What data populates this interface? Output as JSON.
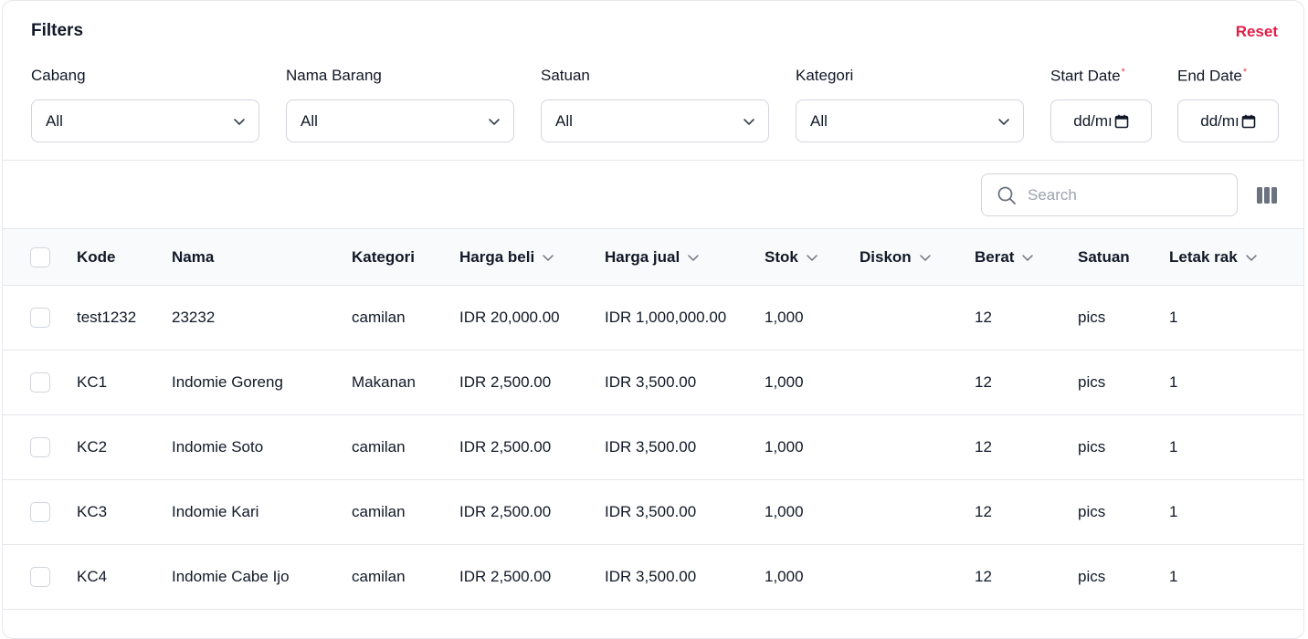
{
  "filters": {
    "title": "Filters",
    "reset_label": "Reset",
    "cabang": {
      "label": "Cabang",
      "value": "All"
    },
    "nama_barang": {
      "label": "Nama Barang",
      "value": "All"
    },
    "satuan": {
      "label": "Satuan",
      "value": "All"
    },
    "kategori": {
      "label": "Kategori",
      "value": "All"
    },
    "start_date": {
      "label": "Start Date",
      "required_mark": "*",
      "value": "dd/mı"
    },
    "end_date": {
      "label": "End Date",
      "required_mark": "*",
      "value": "dd/mı"
    }
  },
  "toolbar": {
    "search_placeholder": "Search",
    "icons": [
      "search-icon",
      "columns-icon"
    ]
  },
  "table": {
    "headers": {
      "kode": "Kode",
      "nama": "Nama",
      "kategori": "Kategori",
      "harga_beli": "Harga beli",
      "harga_jual": "Harga jual",
      "stok": "Stok",
      "diskon": "Diskon",
      "berat": "Berat",
      "satuan": "Satuan",
      "letak_rak": "Letak rak"
    },
    "rows": [
      {
        "kode": "test1232",
        "nama": "23232",
        "kategori": "camilan",
        "harga_beli": "IDR 20,000.00",
        "harga_jual": "IDR 1,000,000.00",
        "stok": "1,000",
        "diskon": "",
        "berat": "12",
        "satuan": "pics",
        "letak_rak": "1"
      },
      {
        "kode": "KC1",
        "nama": "Indomie Goreng",
        "kategori": "Makanan",
        "harga_beli": "IDR 2,500.00",
        "harga_jual": "IDR 3,500.00",
        "stok": "1,000",
        "diskon": "",
        "berat": "12",
        "satuan": "pics",
        "letak_rak": "1"
      },
      {
        "kode": "KC2",
        "nama": "Indomie Soto",
        "kategori": "camilan",
        "harga_beli": "IDR 2,500.00",
        "harga_jual": "IDR 3,500.00",
        "stok": "1,000",
        "diskon": "",
        "berat": "12",
        "satuan": "pics",
        "letak_rak": "1"
      },
      {
        "kode": "KC3",
        "nama": "Indomie Kari",
        "kategori": "camilan",
        "harga_beli": "IDR 2,500.00",
        "harga_jual": "IDR 3,500.00",
        "stok": "1,000",
        "diskon": "",
        "berat": "12",
        "satuan": "pics",
        "letak_rak": "1"
      },
      {
        "kode": "KC4",
        "nama": "Indomie Cabe Ijo",
        "kategori": "camilan",
        "harga_beli": "IDR 2,500.00",
        "harga_jual": "IDR 3,500.00",
        "stok": "1,000",
        "diskon": "",
        "berat": "12",
        "satuan": "pics",
        "letak_rak": "1"
      }
    ]
  },
  "colors": {
    "reset": "#e11d48",
    "required": "#ef4444",
    "border": "#e5e7eb",
    "header_bg": "#f9fafb"
  }
}
